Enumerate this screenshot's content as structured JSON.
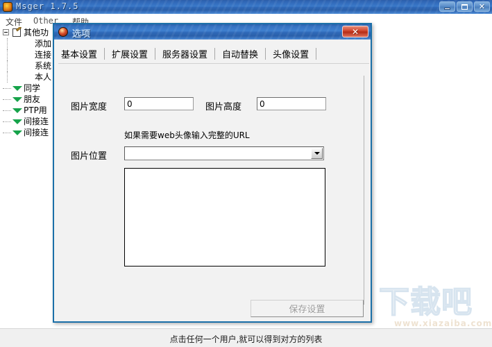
{
  "main_window": {
    "title": "Msger 1.7.5",
    "icon": "app-icon",
    "controls": {
      "minimize": "minimize",
      "maximize": "maximize",
      "close": "close"
    },
    "menu": [
      {
        "label": "文件"
      },
      {
        "label": "Other"
      },
      {
        "label": "帮助"
      }
    ],
    "tree": [
      {
        "label": "其他功",
        "level": 0,
        "icon": "document-icon",
        "expander": "minus"
      },
      {
        "label": "添加",
        "level": 1,
        "icon": "none"
      },
      {
        "label": "连接",
        "level": 1,
        "icon": "none"
      },
      {
        "label": "系统",
        "level": 1,
        "icon": "none"
      },
      {
        "label": "本人",
        "level": 1,
        "icon": "none"
      },
      {
        "label": "同学",
        "level": 0,
        "icon": "green-triangle-icon"
      },
      {
        "label": "朋友",
        "level": 0,
        "icon": "green-triangle-icon"
      },
      {
        "label": "PTP用",
        "level": 0,
        "icon": "green-triangle-icon"
      },
      {
        "label": "间接连",
        "level": 0,
        "icon": "green-triangle-icon"
      },
      {
        "label": "间接连",
        "level": 0,
        "icon": "green-triangle-icon"
      }
    ],
    "statusbar": {
      "text": "点击任何一个用户,就可以得到对方的列表"
    },
    "watermark": {
      "chinese": "下载吧",
      "url": "www.xiazaiba.com"
    }
  },
  "dialog": {
    "title": "选项",
    "icon": "options-icon",
    "close_label": "✕",
    "tabs": [
      {
        "label": "基本设置",
        "active": false
      },
      {
        "label": "扩展设置",
        "active": false
      },
      {
        "label": "服务器设置",
        "active": false
      },
      {
        "label": "自动替换",
        "active": false
      },
      {
        "label": "头像设置",
        "active": true
      }
    ],
    "form": {
      "width_label": "图片宽度",
      "width_value": "0",
      "height_label": "图片高度",
      "height_value": "0",
      "url_hint": "如果需要web头像输入完整的URL",
      "position_label": "图片位置",
      "position_value": "",
      "position_placeholder": ""
    },
    "save_button": "保存设置"
  },
  "colors": {
    "titlebar_blue": "#3a79c9",
    "dialog_border": "#1a6fa8",
    "close_red": "#d24a32",
    "tree_triangle_green": "#16a34a",
    "dialog_face": "#f2f2f2",
    "watermark_blue": "#7ea8cc",
    "watermark_gold": "#c9a06a"
  }
}
